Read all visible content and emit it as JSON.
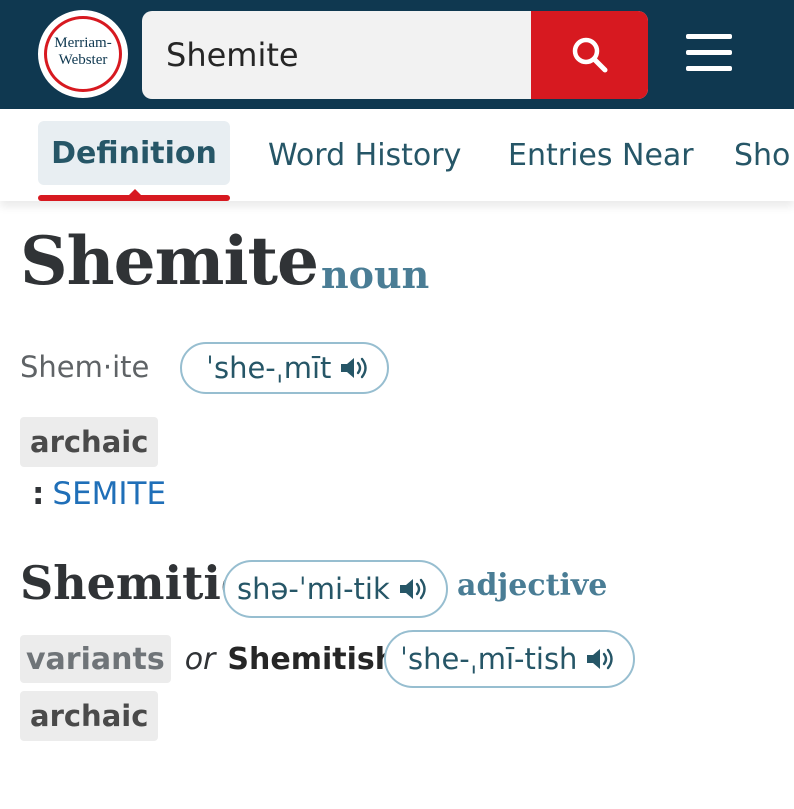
{
  "header": {
    "logo_line1": "Merriam-",
    "logo_line2": "Webster",
    "search_value": "Shemite",
    "colors": {
      "navy": "#0f3850",
      "red": "#d71920"
    }
  },
  "tabs": [
    {
      "label": "Definition",
      "active": true
    },
    {
      "label": "Word History",
      "active": false
    },
    {
      "label": "Entries Near",
      "active": false
    },
    {
      "label": "Sho",
      "active": false
    }
  ],
  "entry": {
    "headword": "Shemite",
    "part_of_speech": "noun",
    "syllables": "Shem·ite",
    "pronunciation": "ˈshe-ˌmīt",
    "label": "archaic",
    "definition_colon": ":",
    "definition_link": "SEMITE"
  },
  "run_on": {
    "word": "Shemitic",
    "pronunciation": "shə-ˈmi-tik",
    "part_of_speech": "adjective",
    "variants_label": "variants",
    "or": "or",
    "variant_word": "Shemitish",
    "variant_pronunciation": "ˈshe-ˌmī-tish",
    "label": "archaic"
  },
  "icons": [
    "search-icon",
    "menu-icon",
    "speaker-icon"
  ]
}
